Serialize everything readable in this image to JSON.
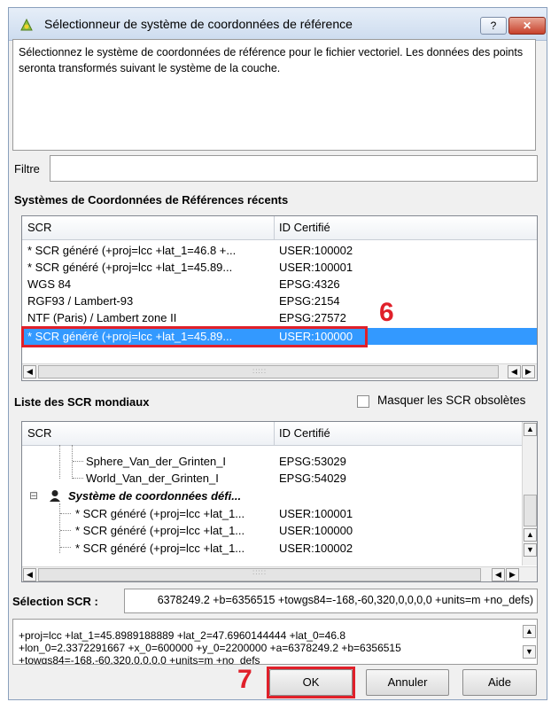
{
  "window": {
    "title": "Sélectionneur de système de coordonnées de référence",
    "help_label": "?",
    "close_label": "✕"
  },
  "description": "Sélectionnez le système de coordonnées de référence pour le fichier vectoriel. Les données des points seronta transformés suivant le système de la couche.",
  "filter": {
    "label": "Filtre",
    "value": ""
  },
  "recent": {
    "title": "Systèmes de Coordonnées de Références récents",
    "headers": [
      "SCR",
      "ID Certifié"
    ],
    "rows": [
      {
        "name": "* SCR généré (+proj=lcc +lat_1=46.8 +...",
        "id": "USER:100002"
      },
      {
        "name": " * SCR généré (+proj=lcc +lat_1=45.89...",
        "id": "USER:100001"
      },
      {
        "name": "WGS 84",
        "id": "EPSG:4326"
      },
      {
        "name": "RGF93 / Lambert-93",
        "id": "EPSG:2154"
      },
      {
        "name": "NTF (Paris) / Lambert zone II",
        "id": "EPSG:27572"
      },
      {
        "name": "* SCR généré (+proj=lcc +lat_1=45.89...",
        "id": "USER:100000"
      }
    ],
    "annotation": "6"
  },
  "world": {
    "title": "Liste des SCR mondiaux",
    "hide_obsolete_label": "Masquer les SCR obsolètes",
    "hide_obsolete_checked": false,
    "headers": [
      "SCR",
      "ID Certifié"
    ],
    "rows": [
      {
        "name": "Sphere_Van_der_Grinten_I",
        "id": "EPSG:53029"
      },
      {
        "name": "World_Van_der_Grinten_I",
        "id": "EPSG:54029"
      },
      {
        "name": "Système de coordonnées défi...",
        "id": ""
      },
      {
        "name": "* SCR généré (+proj=lcc +lat_1...",
        "id": "USER:100001"
      },
      {
        "name": "* SCR généré (+proj=lcc +lat_1...",
        "id": "USER:100000"
      },
      {
        "name": "* SCR généré (+proj=lcc +lat_1...",
        "id": "USER:100002"
      }
    ],
    "expand_symbol": "⊟"
  },
  "selection": {
    "label": "Sélection SCR :",
    "value": "6378249.2 +b=6356515 +towgs84=-168,-60,320,0,0,0,0 +units=m +no_defs)",
    "proj_line1": "+proj=lcc +lat_1=45.8989188889 +lat_2=47.6960144444 +lat_0=46.8",
    "proj_line2": "+lon_0=2.3372291667 +x_0=600000 +y_0=2200000 +a=6378249.2 +b=6356515",
    "proj_line3": "+towgs84=-168,-60,320,0,0,0,0 +units=m +no_defs"
  },
  "buttons": {
    "ok": "OK",
    "cancel": "Annuler",
    "help": "Aide"
  },
  "annotation_ok": "7",
  "colors": {
    "selection": "#3399ff",
    "annotation": "#e0202a"
  }
}
